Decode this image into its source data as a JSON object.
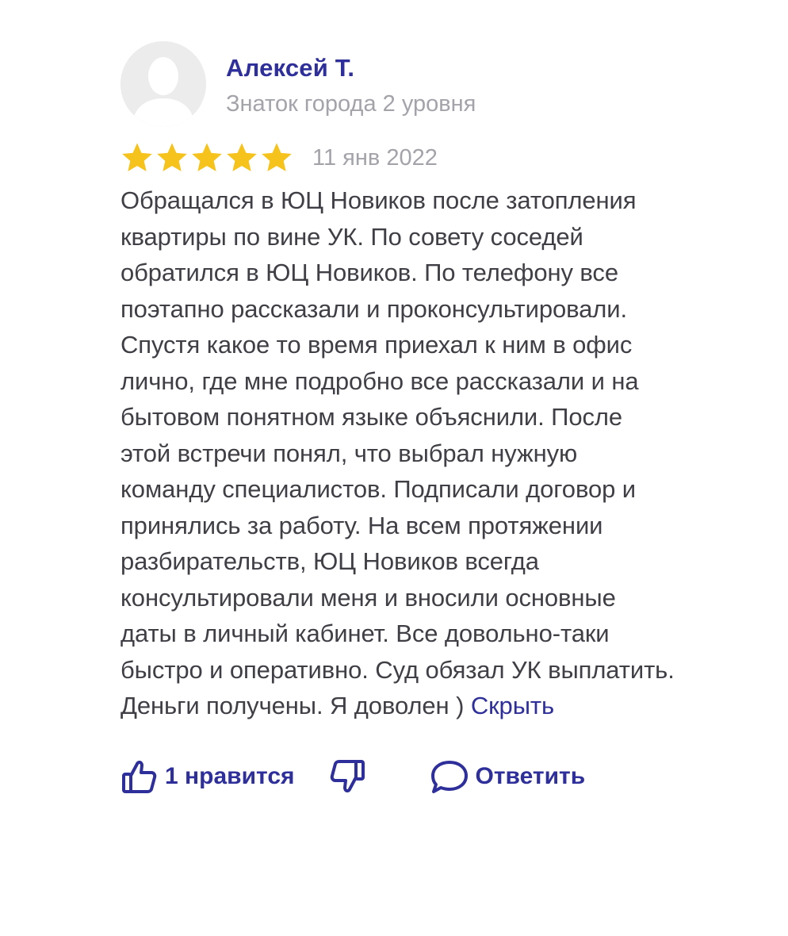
{
  "review": {
    "author": {
      "name": "Алексей Т.",
      "level": "Знаток города 2 уровня",
      "avatar_icon": "user-placeholder-icon"
    },
    "rating": {
      "value": 5,
      "max": 5,
      "star_color": "#f6c21c"
    },
    "date": "11 янв 2022",
    "text": "Обращался в ЮЦ Новиков после затопления квартиры по вине УК. По совету соседей обратился в ЮЦ Новиков. По телефону все поэтапно рассказали и проконсультировали. Спустя какое то время приехал к ним в офис лично, где мне подробно все рассказали и на бытовом понятном языке объяснили. После этой встречи понял, что выбрал нужную команду специалистов. Подписали договор и принялись за работу. На всем протяжении разбирательств, ЮЦ Новиков всегда консультировали меня и вносили основные даты в личный кабинет. Все довольно-таки быстро и оперативно. Суд обязал УК выплатить. Деньги получены. Я доволен )",
    "hide_link": "Скрыть",
    "actions": {
      "like_icon": "thumbs-up-icon",
      "like_label": "1 нравится",
      "dislike_icon": "thumbs-down-icon",
      "reply_icon": "speech-bubble-icon",
      "reply_label": "Ответить"
    }
  },
  "colors": {
    "accent": "#2e2f9a",
    "muted": "#a3a3aa",
    "text": "#3f3f45",
    "star": "#f6c21c"
  }
}
